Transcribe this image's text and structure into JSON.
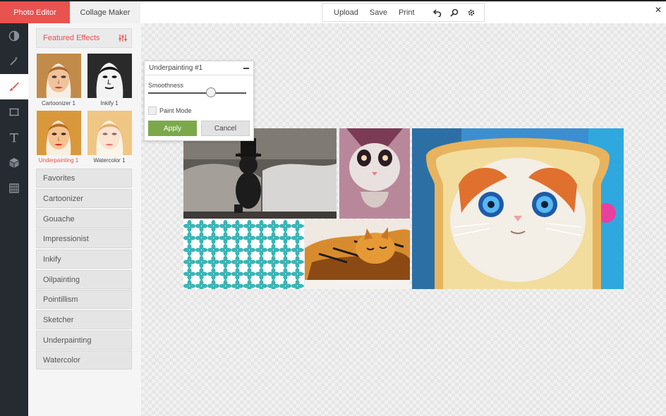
{
  "tabs": {
    "photo_editor": "Photo Editor",
    "collage_maker": "Collage Maker"
  },
  "toolbar": {
    "upload": "Upload",
    "save": "Save",
    "print": "Print"
  },
  "icons": {
    "undo": "undo-icon",
    "search": "search-icon",
    "settings": "gear-icon",
    "close": "close-icon",
    "rail": [
      "exposure-icon",
      "magic-wand-icon",
      "brush-icon",
      "crop-icon",
      "text-icon",
      "cube-icon",
      "texture-icon"
    ]
  },
  "colors": {
    "accent": "#e8524f",
    "apply": "#7ba94a",
    "rail_bg": "#262b31"
  },
  "panel": {
    "featured_title": "Featured Effects",
    "thumbnails": [
      {
        "label": "Cartoonizer 1",
        "selected": false
      },
      {
        "label": "Inkify 1",
        "selected": false
      },
      {
        "label": "Underpainting 1",
        "selected": true
      },
      {
        "label": "Watercolor 1",
        "selected": false
      }
    ],
    "categories": [
      "Favorites",
      "Cartoonizer",
      "Gouache",
      "Impressionist",
      "Inkify",
      "Oilpainting",
      "Pointillism",
      "Sketcher",
      "Underpainting",
      "Watercolor"
    ]
  },
  "dialog": {
    "title": "Underpainting #1",
    "smoothness_label": "Smoothness",
    "smoothness_value": 0.64,
    "paint_mode_label": "Paint Mode",
    "paint_mode_checked": false,
    "apply_label": "Apply",
    "cancel_label": "Cancel"
  }
}
